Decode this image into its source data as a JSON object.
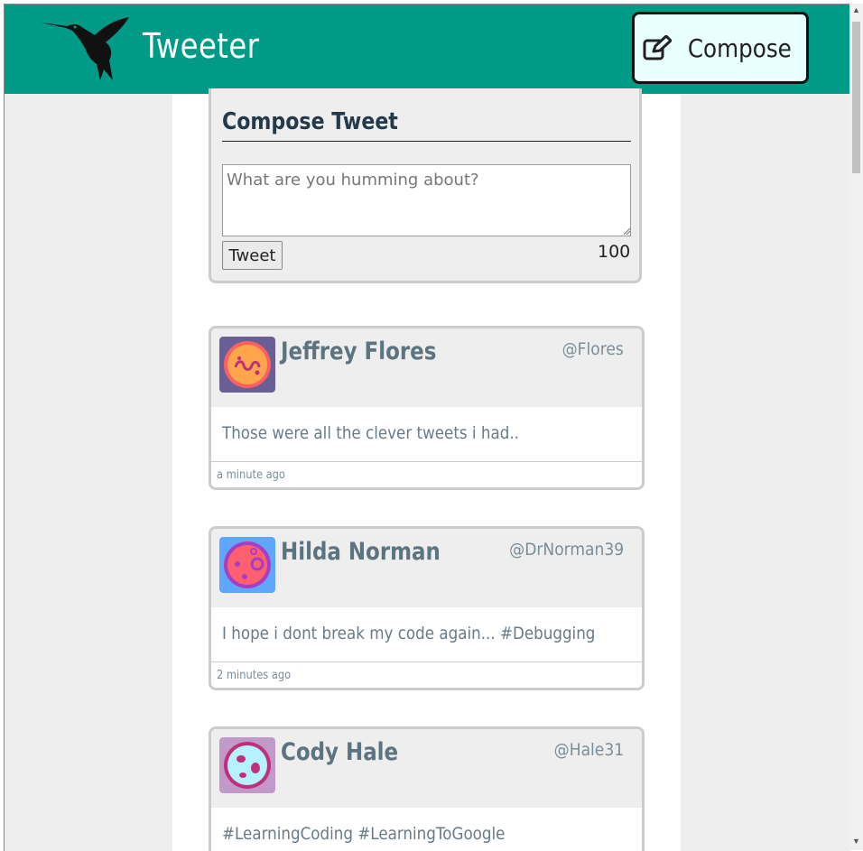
{
  "header": {
    "brand": "Tweeter",
    "compose_label": "Compose",
    "bg_color": "#009b87"
  },
  "compose": {
    "title": "Compose Tweet",
    "placeholder": "What are you humming about?",
    "button_label": "Tweet",
    "counter": "100"
  },
  "tweets": [
    {
      "name": "Jeffrey Flores",
      "handle": "@Flores",
      "text": "Those were all the clever tweets i had..",
      "time": "a minute ago"
    },
    {
      "name": "Hilda Norman",
      "handle": "@DrNorman39",
      "text": "I hope i dont break my code again... #Debugging",
      "time": "2 minutes ago"
    },
    {
      "name": "Cody Hale",
      "handle": "@Hale31",
      "text": "#LearningCoding #LearningToGoogle",
      "time": ""
    }
  ]
}
